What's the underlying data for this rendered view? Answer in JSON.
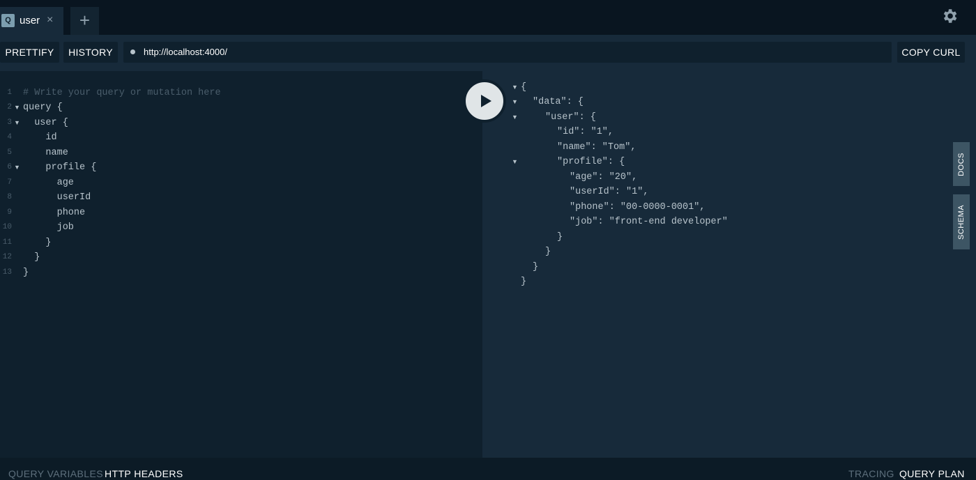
{
  "tabs": [
    {
      "badge": "Q",
      "label": "user",
      "close": "×"
    }
  ],
  "add_tab_label": "+",
  "toolbar": {
    "prettify": "PRETTIFY",
    "history": "HISTORY",
    "url": "http://localhost:4000/",
    "copy_curl": "COPY CURL"
  },
  "editor": {
    "lines": [
      {
        "n": "1",
        "text": "# Write your query or mutation here"
      },
      {
        "n": "2",
        "text": "query {"
      },
      {
        "n": "3",
        "text": "  user {"
      },
      {
        "n": "4",
        "text": "    id"
      },
      {
        "n": "5",
        "text": "    name"
      },
      {
        "n": "6",
        "text": "    profile {"
      },
      {
        "n": "7",
        "text": "      age"
      },
      {
        "n": "8",
        "text": "      userId"
      },
      {
        "n": "9",
        "text": "      phone"
      },
      {
        "n": "10",
        "text": "      job"
      },
      {
        "n": "11",
        "text": "    }"
      },
      {
        "n": "12",
        "text": "  }"
      },
      {
        "n": "13",
        "text": "}"
      }
    ]
  },
  "result": {
    "lines": [
      "{",
      "\"data\": {",
      "\"user\": {",
      "\"id\": \"1\",",
      "\"name\": \"Tom\",",
      "\"profile\": {",
      "\"age\": \"20\",",
      "\"userId\": \"1\",",
      "\"phone\": \"00-0000-0001\",",
      "\"job\": \"front-end developer\"",
      "}",
      "}",
      "}",
      "}"
    ]
  },
  "side_tabs": {
    "docs": "DOCS",
    "schema": "SCHEMA"
  },
  "bottom": {
    "query_variables": "QUERY VARIABLES",
    "http_headers": "HTTP HEADERS",
    "tracing": "TRACING",
    "query_plan": "QUERY PLAN"
  },
  "icons": {
    "settings": "gear-icon",
    "play": "play-icon",
    "fold": "fold-arrow-icon"
  },
  "colors": {
    "background": "#0f202d",
    "panel": "#172a3a",
    "accent_tab": "#3d5564",
    "text_muted": "#b7c3cb"
  }
}
